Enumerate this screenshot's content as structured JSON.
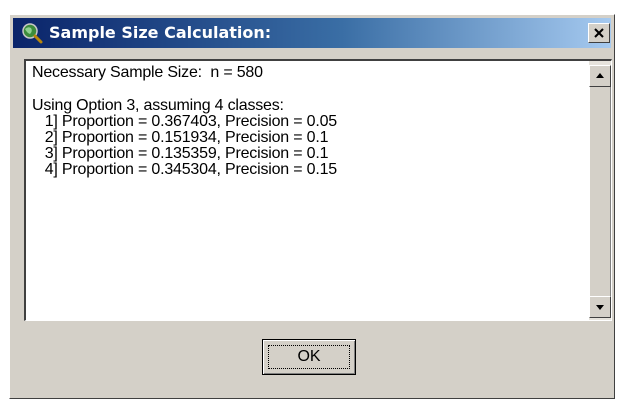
{
  "window": {
    "title": "Sample Size Calculation:",
    "icon": "magnifier-globe-icon",
    "close_icon": "close-icon",
    "colors": {
      "title_active": "#0a246a",
      "title_gradient_end": "#a6caf0",
      "face": "#d4d0c8"
    }
  },
  "output": {
    "lines": [
      "Necessary Sample Size:  n = 580",
      "",
      "Using Option 3, assuming 4 classes:",
      "   1] Proportion = 0.367403, Precision = 0.05",
      "   2] Proportion = 0.151934, Precision = 0.1",
      "   3] Proportion = 0.135359, Precision = 0.1",
      "   4] Proportion = 0.345304, Precision = 0.15"
    ]
  },
  "scrollbar": {
    "up_icon": "arrow-up-icon",
    "down_icon": "arrow-down-icon"
  },
  "buttons": {
    "ok_label": "OK"
  }
}
